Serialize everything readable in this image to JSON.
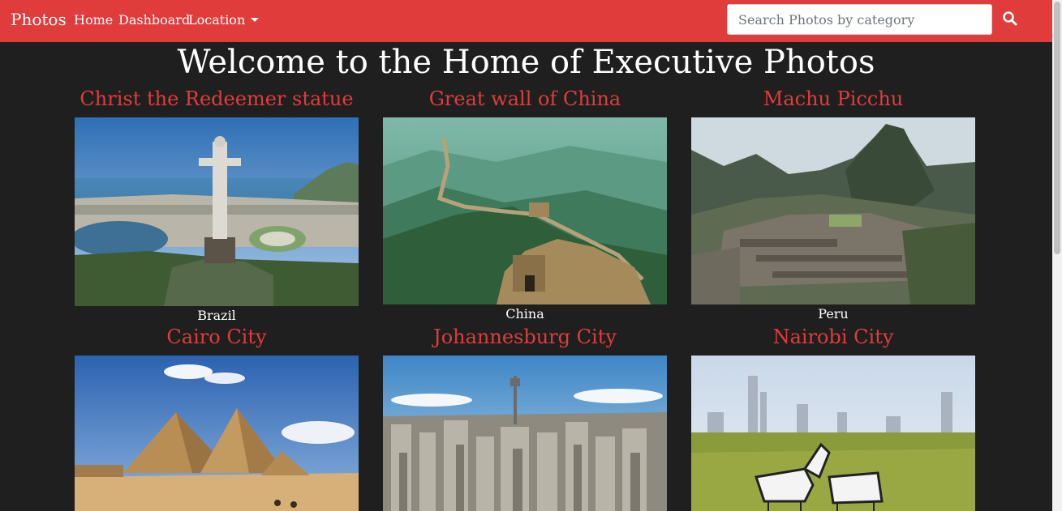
{
  "navbar": {
    "brand": "Photos",
    "home": "Home",
    "dashboard": "Dashboard",
    "location": "Location",
    "search_placeholder": "Search Photos by category",
    "search_icon": "search-icon",
    "bg_color": "#e03c3c"
  },
  "page": {
    "title": "Welcome to the Home of Executive Photos",
    "accent_color": "#e03c3c",
    "background_color": "#1f1f1f"
  },
  "photos": [
    {
      "title": "Christ the Redeemer statue",
      "location": "Brazil"
    },
    {
      "title": "Great wall of China",
      "location": "China"
    },
    {
      "title": "Machu Picchu",
      "location": "Peru"
    },
    {
      "title": "Cairo City",
      "location": ""
    },
    {
      "title": "Johannesburg City",
      "location": ""
    },
    {
      "title": "Nairobi City",
      "location": ""
    }
  ]
}
